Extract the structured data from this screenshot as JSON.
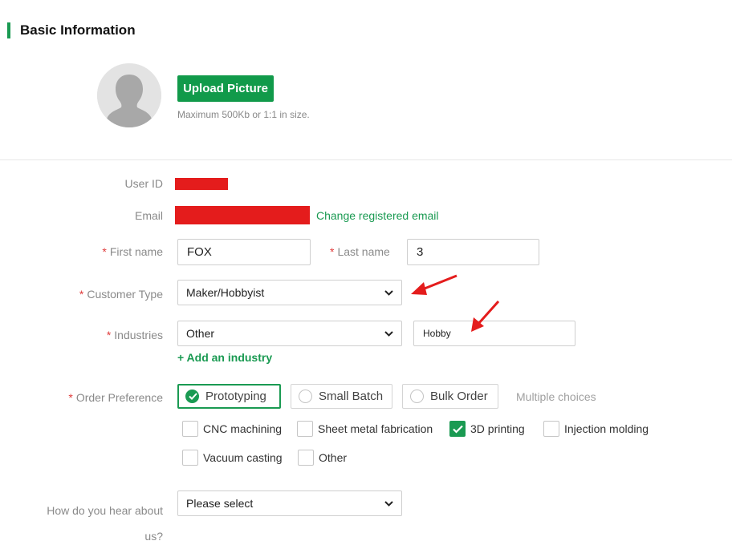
{
  "section": {
    "title": "Basic Information"
  },
  "avatar": {
    "icon": "user-silhouette-icon"
  },
  "upload": {
    "button_label": "Upload Picture",
    "hint": "Maximum 500Kb or 1:1 in size."
  },
  "fields": {
    "user_id": {
      "label": "User ID"
    },
    "email": {
      "label": "Email",
      "change_link": "Change registered email"
    },
    "first_name": {
      "required": "*",
      "label": "First name",
      "value": "FOX"
    },
    "last_name": {
      "required": "*",
      "label": "Last name",
      "value": "3"
    },
    "customer_type": {
      "required": "*",
      "label": "Customer Type",
      "value": "Maker/Hobbyist"
    },
    "industries": {
      "required": "*",
      "label": "Industries",
      "value": "Other",
      "other_value": "Hobby",
      "add_link": "+ Add an industry"
    },
    "order_preference": {
      "required": "*",
      "label": "Order Preference",
      "options": [
        "Prototyping",
        "Small Batch",
        "Bulk Order"
      ],
      "selected": "Prototyping",
      "hint": "Multiple choices",
      "processes": [
        "CNC machining",
        "Sheet metal fabrication",
        "3D printing",
        "Injection molding",
        "Vacuum casting",
        "Other"
      ],
      "processes_checked": [
        "3D printing"
      ]
    },
    "hear_about": {
      "label_line1": "How do you hear about",
      "label_line2": "us?",
      "value": "Please select"
    }
  },
  "colors": {
    "accent": "#1a9a52",
    "required": "#e03b3b",
    "redaction": "#e41c1c",
    "annotation_arrow": "#e41c1c"
  }
}
